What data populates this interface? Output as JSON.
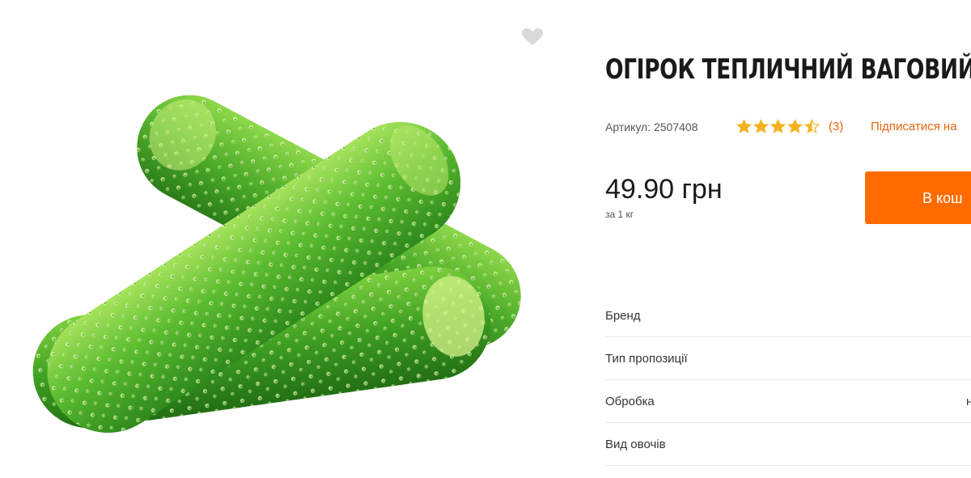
{
  "product": {
    "title": "ОГІРОК ТЕПЛИЧНИЙ ВАГОВИЙ",
    "sku_text": "Артикул: 2507408",
    "rating": {
      "value": 4.5,
      "max": 5
    },
    "reviews_count_text": "(3)",
    "subscribe_text": "Підписатися на",
    "price_text": "49.90 грн",
    "unit_text": "за 1 кг",
    "add_to_cart_label": "В кош",
    "image_subject": "cucumbers-photo"
  },
  "specs": [
    {
      "label": "Бренд",
      "value": ""
    },
    {
      "label": "Тип пропозиції",
      "value": ""
    },
    {
      "label": "Обробка",
      "value": "н"
    },
    {
      "label": "Вид овочів",
      "value": ""
    }
  ],
  "icons": {
    "favorite": "heart-icon",
    "star": "star-icon"
  },
  "colors": {
    "accent": "#ff6b00",
    "link": "#e8650f",
    "star": "#f5b120",
    "heart": "#d9d9d9"
  }
}
